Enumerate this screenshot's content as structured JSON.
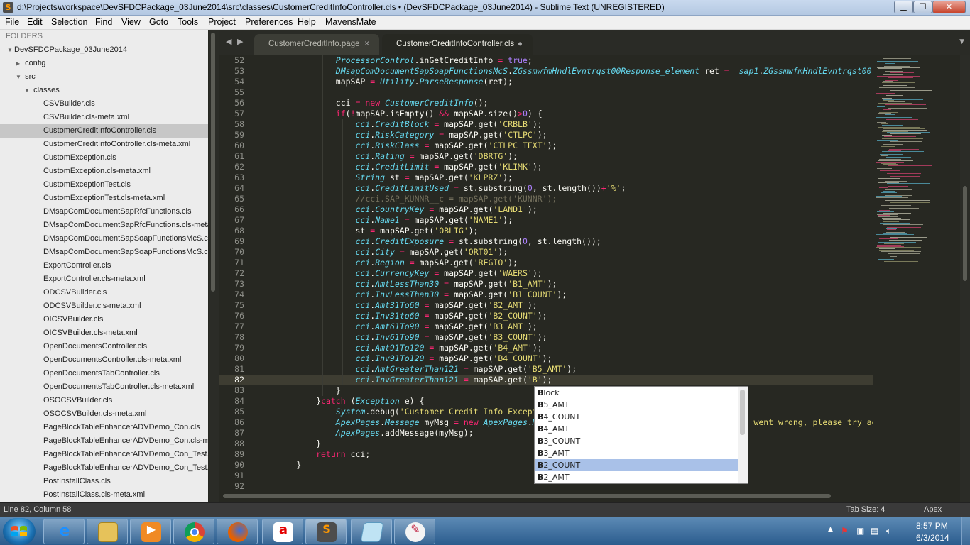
{
  "window": {
    "title": "d:\\Projects\\workspace\\DevSFDCPackage_03June2014\\src\\classes\\CustomerCreditInfoController.cls • (DevSFDCPackage_03June2014) - Sublime Text (UNREGISTERED)"
  },
  "menu": [
    "File",
    "Edit",
    "Selection",
    "Find",
    "View",
    "Goto",
    "Tools",
    "Project",
    "Preferences",
    "Help",
    "MavensMate"
  ],
  "sidebar": {
    "header": "FOLDERS",
    "root": "DevSFDCPackage_03June2014",
    "folders": [
      "config",
      "src",
      "classes"
    ],
    "files": [
      "CSVBuilder.cls",
      "CSVBuilder.cls-meta.xml",
      "CustomerCreditInfoController.cls",
      "CustomerCreditInfoController.cls-meta.xml",
      "CustomException.cls",
      "CustomException.cls-meta.xml",
      "CustomExceptionTest.cls",
      "CustomExceptionTest.cls-meta.xml",
      "DMsapComDocumentSapRfcFunctions.cls",
      "DMsapComDocumentSapRfcFunctions.cls-meta.xml",
      "DMsapComDocumentSapSoapFunctionsMcS.cls",
      "DMsapComDocumentSapSoapFunctionsMcS.cls-meta.xml",
      "ExportController.cls",
      "ExportController.cls-meta.xml",
      "ODCSVBuilder.cls",
      "ODCSVBuilder.cls-meta.xml",
      "OICSVBuilder.cls",
      "OICSVBuilder.cls-meta.xml",
      "OpenDocumentsController.cls",
      "OpenDocumentsController.cls-meta.xml",
      "OpenDocumentsTabController.cls",
      "OpenDocumentsTabController.cls-meta.xml",
      "OSOCSVBuilder.cls",
      "OSOCSVBuilder.cls-meta.xml",
      "PageBlockTableEnhancerADVDemo_Con.cls",
      "PageBlockTableEnhancerADVDemo_Con.cls-meta.xml",
      "PageBlockTableEnhancerADVDemo_Con_Test.cls",
      "PageBlockTableEnhancerADVDemo_Con_Test.cls-meta.xml",
      "PostInstallClass.cls",
      "PostInstallClass.cls-meta.xml"
    ],
    "selected_index": 2
  },
  "tabs": [
    {
      "label": "CustomerCreditInfo.page",
      "close": "×"
    },
    {
      "label": "CustomerCreditInfoController.cls",
      "close": "●"
    }
  ],
  "editor": {
    "first_line": 52,
    "current_line": 82
  },
  "autocomplete": {
    "items": [
      "Block",
      "B5_AMT",
      "B4_COUNT",
      "B4_AMT",
      "B3_COUNT",
      "B3_AMT",
      "B2_COUNT",
      "B2_AMT"
    ],
    "active_index": 6
  },
  "status": {
    "position": "Line 82, Column 58",
    "tab_size": "Tab Size: 4",
    "syntax": "Apex"
  },
  "taskbar": {
    "apps": [
      "internet-explorer",
      "file-explorer",
      "media-player",
      "chrome",
      "firefox",
      "airtel",
      "sublime-text",
      "notepad",
      "paint-tool"
    ],
    "time": "8:57 PM",
    "date": "6/3/2014"
  }
}
